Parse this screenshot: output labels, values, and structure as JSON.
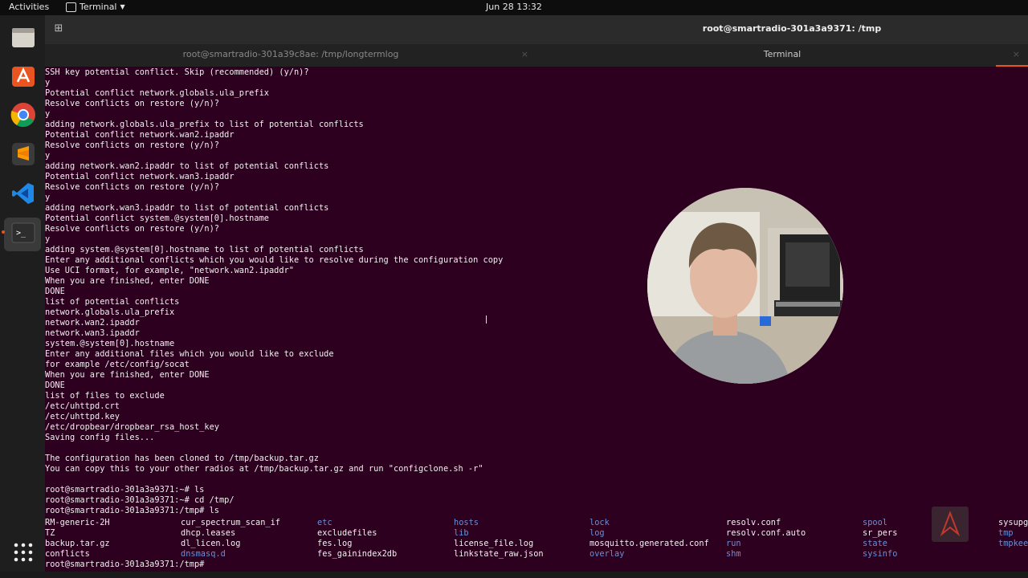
{
  "topbar": {
    "activities": "Activities",
    "app_menu": "Terminal",
    "clock": "Jun 28  13:32"
  },
  "dock": {
    "apps": [
      "files-icon",
      "software-icon",
      "chrome-icon",
      "sublime-icon",
      "vscode-icon",
      "terminal-icon"
    ]
  },
  "window": {
    "title": "root@smartradio-301a3a9371: /tmp"
  },
  "tabs": [
    {
      "label": "root@smartradio-301a39c8ae: /tmp/longtermlog"
    },
    {
      "label": "Terminal"
    }
  ],
  "terminal": {
    "lines": [
      "SSH key potential conflict. Skip (recommended) (y/n)?",
      "y",
      "Potential conflict network.globals.ula_prefix",
      "Resolve conflicts on restore (y/n)?",
      "y",
      "adding network.globals.ula_prefix to list of potential conflicts",
      "Potential conflict network.wan2.ipaddr",
      "Resolve conflicts on restore (y/n)?",
      "y",
      "adding network.wan2.ipaddr to list of potential conflicts",
      "Potential conflict network.wan3.ipaddr",
      "Resolve conflicts on restore (y/n)?",
      "y",
      "adding network.wan3.ipaddr to list of potential conflicts",
      "Potential conflict system.@system[0].hostname",
      "Resolve conflicts on restore (y/n)?",
      "y",
      "adding system.@system[0].hostname to list of potential conflicts",
      "Enter any additional conflicts which you would like to resolve during the configuration copy",
      "Use UCI format, for example, \"network.wan2.ipaddr\"",
      "When you are finished, enter DONE",
      "DONE",
      "list of potential conflicts",
      "network.globals.ula_prefix",
      "network.wan2.ipaddr",
      "network.wan3.ipaddr",
      "system.@system[0].hostname",
      "Enter any additional files which you would like to exclude",
      "for example /etc/config/socat",
      "When you are finished, enter DONE",
      "DONE",
      "list of files to exclude",
      "/etc/uhttpd.crt",
      "/etc/uhttpd.key",
      "/etc/dropbear/dropbear_rsa_host_key",
      "Saving config files...",
      "",
      "The configuration has been cloned to /tmp/backup.tar.gz",
      "You can copy this to your other radios at /tmp/backup.tar.gz and run \"configclone.sh -r\"",
      "",
      "root@smartradio-301a3a9371:~# ls",
      "root@smartradio-301a3a9371:~# cd /tmp/",
      "root@smartradio-301a3a9371:/tmp# ls"
    ],
    "ls_rows": [
      [
        "RM-generic-2H",
        "cur_spectrum_scan_if",
        "etc",
        "hosts",
        "lock",
        "resolv.conf",
        "spool",
        "sysupg"
      ],
      [
        "TZ",
        "dhcp.leases",
        "excludefiles",
        "lib",
        "log",
        "resolv.conf.auto",
        "sr_pers",
        "tmp"
      ],
      [
        "backup.tar.gz",
        "dl_licen.log",
        "fes.log",
        "license_file.log",
        "mosquitto.generated.conf",
        "run",
        "state",
        "tmpkee"
      ],
      [
        "conflicts",
        "dnsmasq.d",
        "fes_gainindex2db",
        "linkstate_raw.json",
        "overlay",
        "shm",
        "sysinfo",
        ""
      ]
    ],
    "ls_dir_flags": [
      [
        false,
        false,
        true,
        true,
        true,
        false,
        true,
        false
      ],
      [
        false,
        false,
        false,
        true,
        true,
        false,
        false,
        true
      ],
      [
        false,
        false,
        false,
        false,
        false,
        true,
        true,
        true
      ],
      [
        false,
        true,
        false,
        false,
        true,
        true,
        true,
        false
      ]
    ],
    "last_prompt": "root@smartradio-301a3a9371:/tmp# ",
    "colors": {
      "background": "#2c001e",
      "text": "#f0f0f0",
      "directory": "#6b8fd8"
    }
  }
}
